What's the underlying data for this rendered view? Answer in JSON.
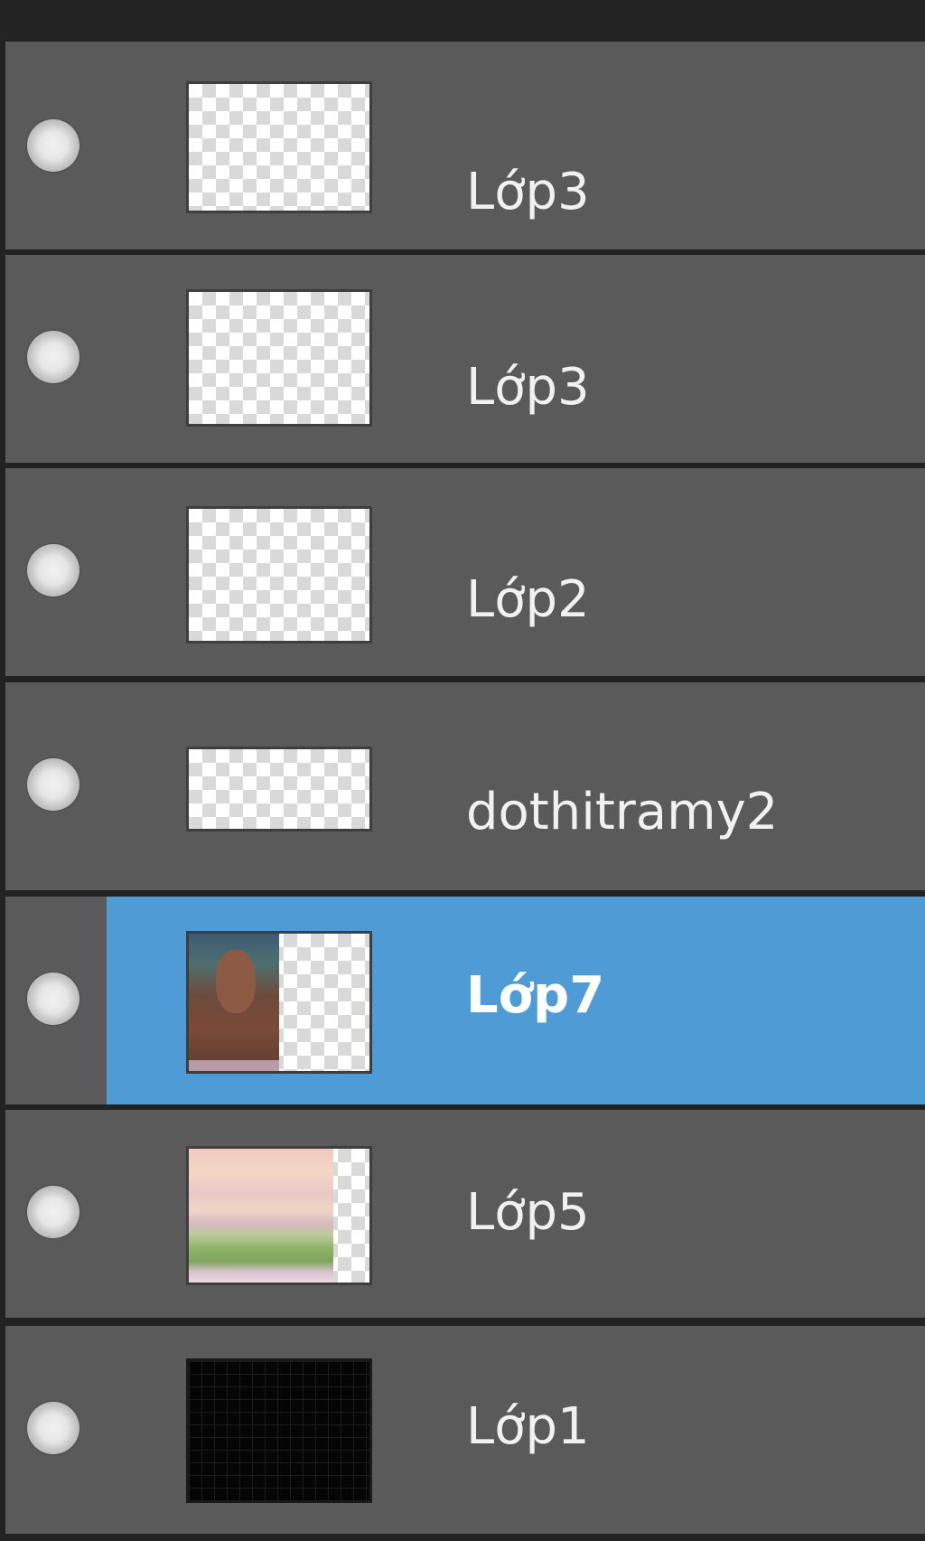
{
  "layers": [
    {
      "name": "Lớp3",
      "selected": false,
      "thumb": "transparent"
    },
    {
      "name": "Lớp3",
      "selected": false,
      "thumb": "transparent"
    },
    {
      "name": "Lớp2",
      "selected": false,
      "thumb": "transparent"
    },
    {
      "name": "dothitramy2",
      "selected": false,
      "thumb": "transparent"
    },
    {
      "name": "Lớp7",
      "selected": true,
      "thumb": "photo"
    },
    {
      "name": "Lớp5",
      "selected": false,
      "thumb": "landscape"
    },
    {
      "name": "Lớp1",
      "selected": false,
      "thumb": "black"
    }
  ],
  "colors": {
    "panel_bg": "#5a5a5a",
    "divider": "#222222",
    "selection": "#4f9bd5",
    "text": "#f1f1f1"
  }
}
